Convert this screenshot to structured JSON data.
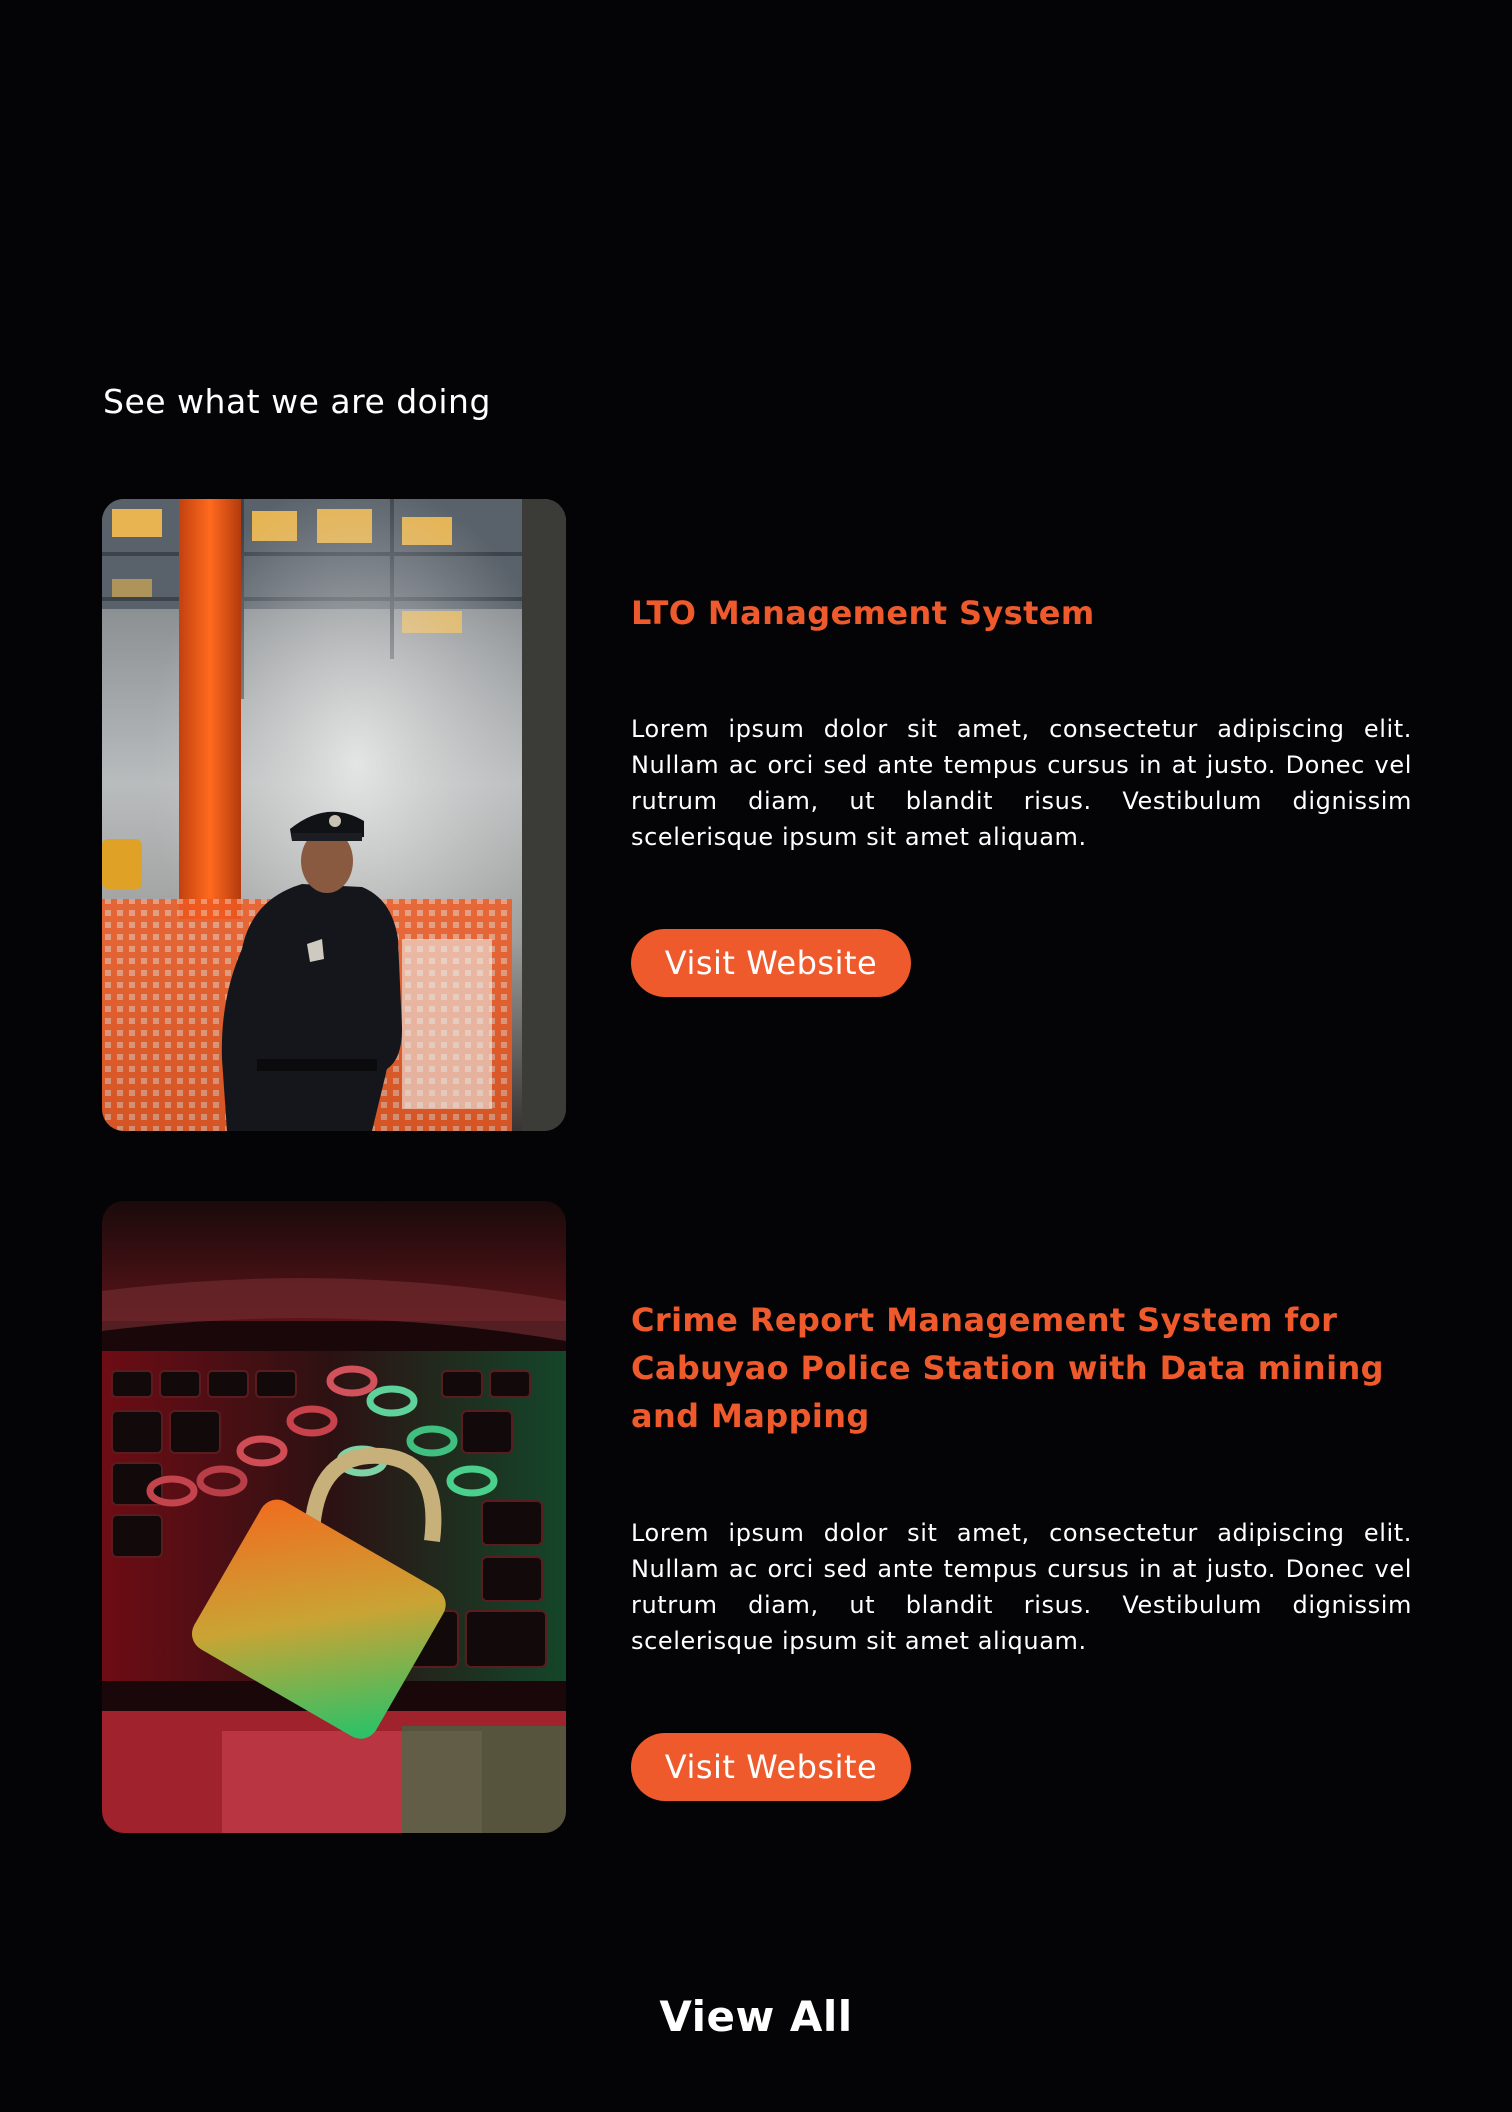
{
  "section": {
    "heading": "See what we are doing"
  },
  "colors": {
    "background": "#040305",
    "accent": "#ef5a2c",
    "text": "#ffffff"
  },
  "projects": [
    {
      "title": "LTO Management System",
      "description": "Lorem ipsum dolor sit amet, consectetur adipiscing elit. Nullam ac orci sed ante tempus cursus in at justo. Donec vel rutrum diam, ut blandit risus. Vestibulum dignissim scelerisque ipsum sit amet aliquam.",
      "button_label": "Visit Website",
      "image_subject": "police-officer-photo"
    },
    {
      "title": "Crime Report Management System for Cabuyao Police Station with Data mining and Mapping",
      "description": "Lorem ipsum dolor sit amet, consectetur adipiscing elit. Nullam ac orci sed ante tempus cursus in at justo. Donec vel rutrum diam, ut blandit risus. Vestibulum dignissim scelerisque ipsum sit amet aliquam.",
      "button_label": "Visit Website",
      "image_subject": "padlock-chain-keyboard-photo"
    }
  ],
  "footer": {
    "view_all_label": "View All"
  }
}
